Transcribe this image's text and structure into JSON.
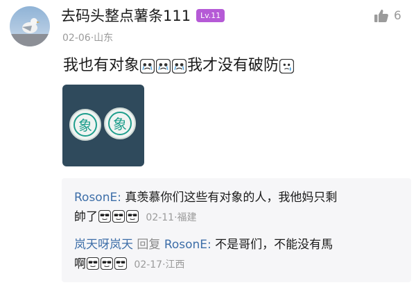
{
  "post": {
    "username": "去码头整点薯条111",
    "level": "Lv.11",
    "date": "02-06",
    "location": "山东",
    "like_count": "6",
    "text_part1": "我也有对象",
    "text_part2": "我才没有破防"
  },
  "replies": [
    {
      "author": "RosonE:",
      "text": "真羡慕你们这些有对象的人，我他妈只剩",
      "text2": "帥了",
      "date": "02-11",
      "location": "福建"
    },
    {
      "author": "岚天呀岚天",
      "reply_word": "回复",
      "reply_to": "RosonE:",
      "text": "不是哥们，不能没有馬",
      "text2": "啊",
      "date": "02-17",
      "location": "江西"
    }
  ],
  "icons": {
    "avatar": "seagull-avatar",
    "like": "thumbs-up-icon",
    "emoji_sad": "crying-emoji",
    "emoji_cool": "sunglasses-emoji"
  },
  "colors": {
    "level_badge": "#b55ad6",
    "author_link": "#3d6ea8",
    "reply_bg": "#f6f6f8"
  }
}
